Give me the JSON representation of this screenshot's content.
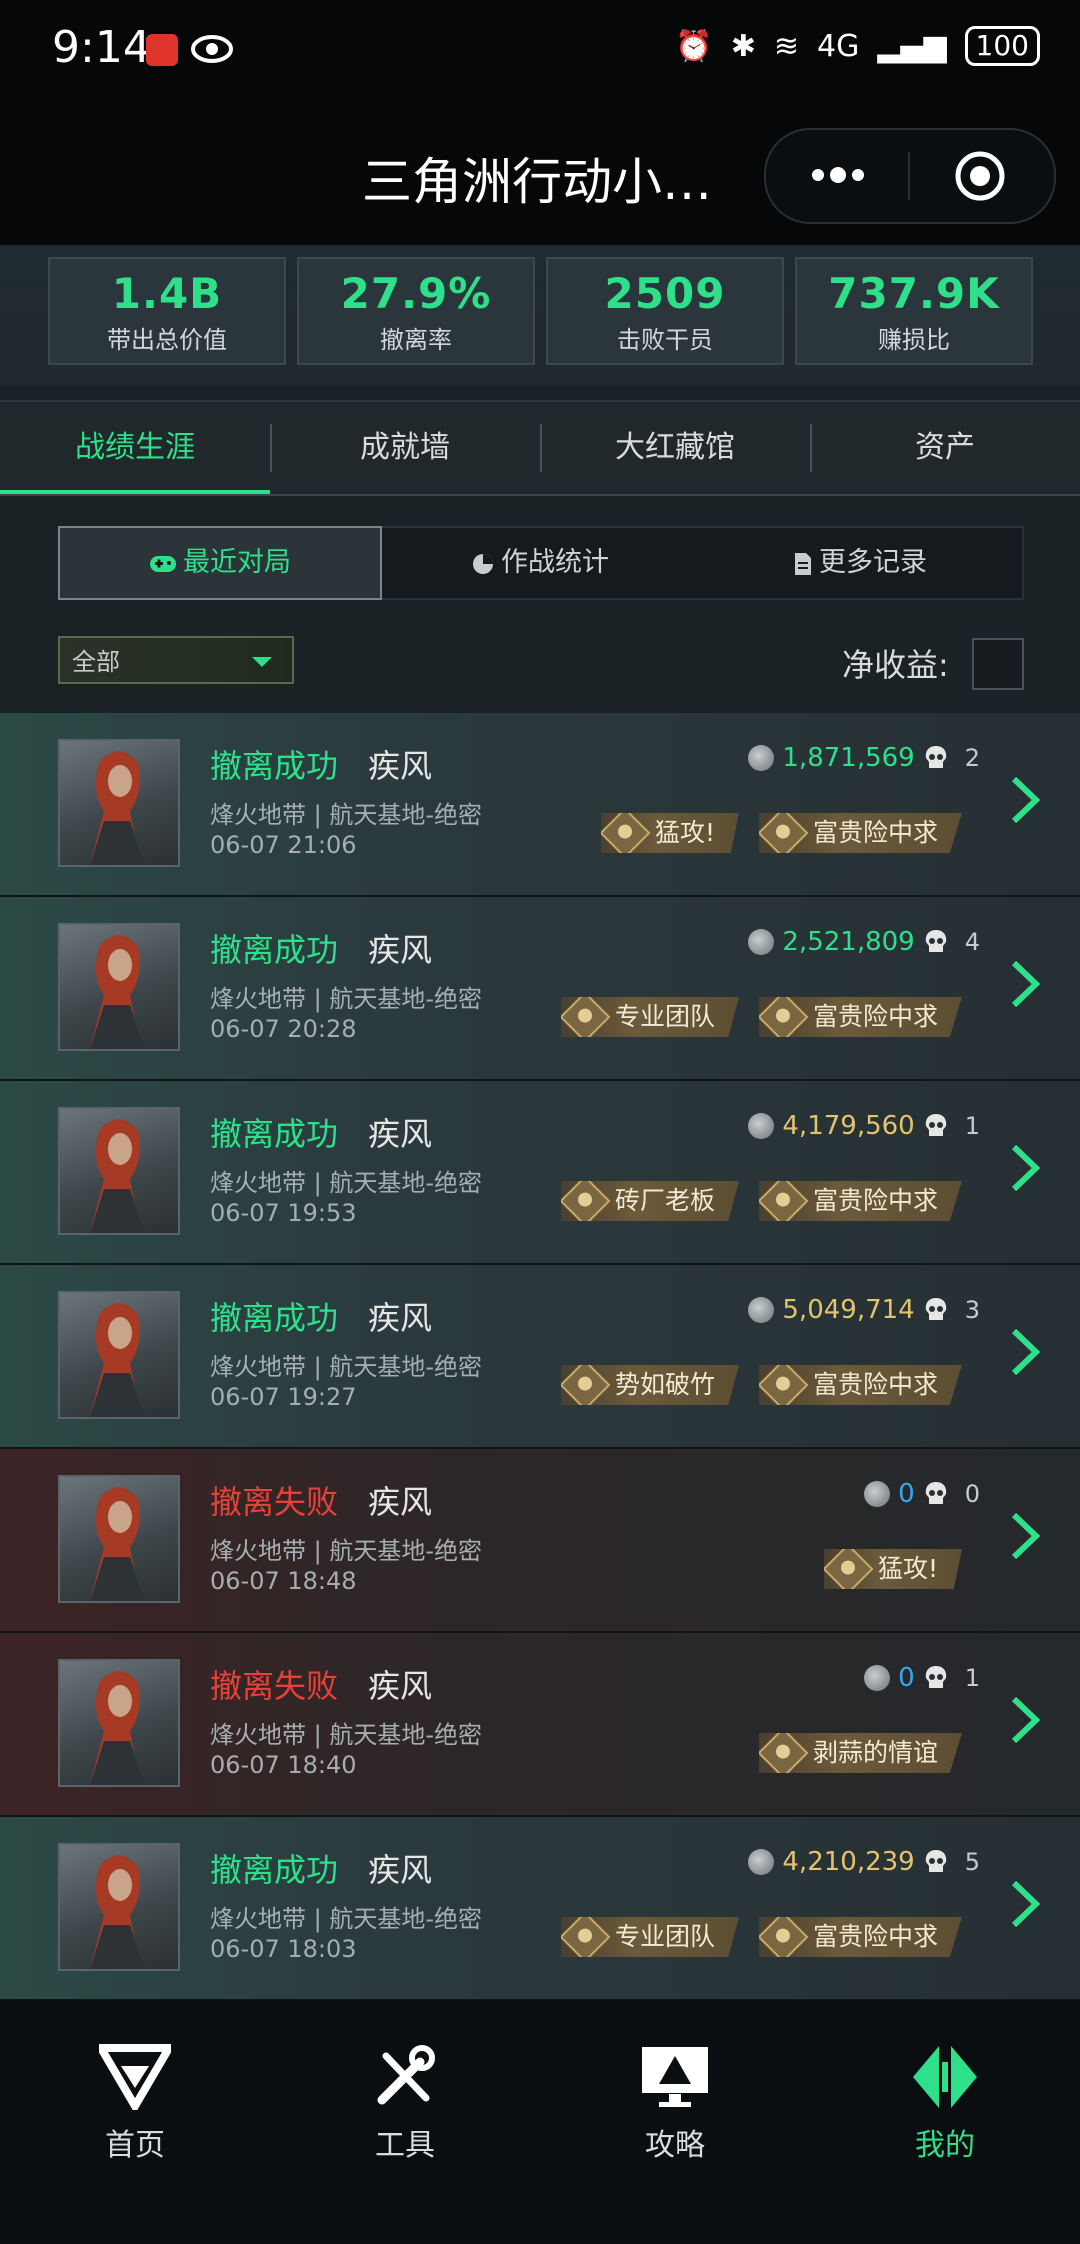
{
  "status_bar": {
    "time": "9:14",
    "network": "4G",
    "battery": "100"
  },
  "nav": {
    "title": "三角洲行动小…"
  },
  "stats": [
    {
      "value": "1.4B",
      "label": "带出总价值"
    },
    {
      "value": "27.9%",
      "label": "撤离率"
    },
    {
      "value": "2509",
      "label": "击败干员"
    },
    {
      "value": "737.9K",
      "label": "赚损比"
    }
  ],
  "tabs": [
    {
      "label": "战绩生涯",
      "active": true
    },
    {
      "label": "成就墙",
      "active": false
    },
    {
      "label": "大红藏馆",
      "active": false
    },
    {
      "label": "资产",
      "active": false
    }
  ],
  "segments": [
    {
      "label": "最近对局",
      "icon": "gamepad-icon",
      "active": true
    },
    {
      "label": "作战统计",
      "icon": "pie-chart-icon",
      "active": false
    },
    {
      "label": "更多记录",
      "icon": "document-icon",
      "active": false
    }
  ],
  "filter": {
    "selected": "全部"
  },
  "net_income_label": "净收益:",
  "matches": [
    {
      "result": "撤离成功",
      "status": "ok",
      "agent": "疾风",
      "location": "烽火地带 | 航天基地-绝密",
      "datetime": "06-07 21:06",
      "value": "1,871,569",
      "value_color": "green",
      "kills": "2",
      "tags": [
        "猛攻!",
        "富贵险中求"
      ]
    },
    {
      "result": "撤离成功",
      "status": "ok",
      "agent": "疾风",
      "location": "烽火地带 | 航天基地-绝密",
      "datetime": "06-07 20:28",
      "value": "2,521,809",
      "value_color": "green",
      "kills": "4",
      "tags": [
        "专业团队",
        "富贵险中求"
      ]
    },
    {
      "result": "撤离成功",
      "status": "ok",
      "agent": "疾风",
      "location": "烽火地带 | 航天基地-绝密",
      "datetime": "06-07 19:53",
      "value": "4,179,560",
      "value_color": "gold",
      "kills": "1",
      "tags": [
        "砖厂老板",
        "富贵险中求"
      ]
    },
    {
      "result": "撤离成功",
      "status": "ok",
      "agent": "疾风",
      "location": "烽火地带 | 航天基地-绝密",
      "datetime": "06-07 19:27",
      "value": "5,049,714",
      "value_color": "gold",
      "kills": "3",
      "tags": [
        "势如破竹",
        "富贵险中求"
      ]
    },
    {
      "result": "撤离失败",
      "status": "fail",
      "agent": "疾风",
      "location": "烽火地带 | 航天基地-绝密",
      "datetime": "06-07 18:48",
      "value": "0",
      "value_color": "blue",
      "kills": "0",
      "tags": [
        "猛攻!"
      ]
    },
    {
      "result": "撤离失败",
      "status": "fail",
      "agent": "疾风",
      "location": "烽火地带 | 航天基地-绝密",
      "datetime": "06-07 18:40",
      "value": "0",
      "value_color": "blue",
      "kills": "1",
      "tags": [
        "剥蒜的情谊"
      ]
    },
    {
      "result": "撤离成功",
      "status": "ok",
      "agent": "疾风",
      "location": "烽火地带 | 航天基地-绝密",
      "datetime": "06-07 18:03",
      "value": "4,210,239",
      "value_color": "gold",
      "kills": "5",
      "tags": [
        "专业团队",
        "富贵险中求"
      ]
    }
  ],
  "bottom_nav": [
    {
      "label": "首页",
      "icon": "delta-logo-icon",
      "active": false
    },
    {
      "label": "工具",
      "icon": "tools-icon",
      "active": false
    },
    {
      "label": "攻略",
      "icon": "guide-monitor-icon",
      "active": false
    },
    {
      "label": "我的",
      "icon": "profile-icon",
      "active": true
    }
  ],
  "colors": {
    "accent": "#2fe08a",
    "fail": "#e8413a",
    "gold": "#e3c46a",
    "blue": "#35a7e8"
  }
}
